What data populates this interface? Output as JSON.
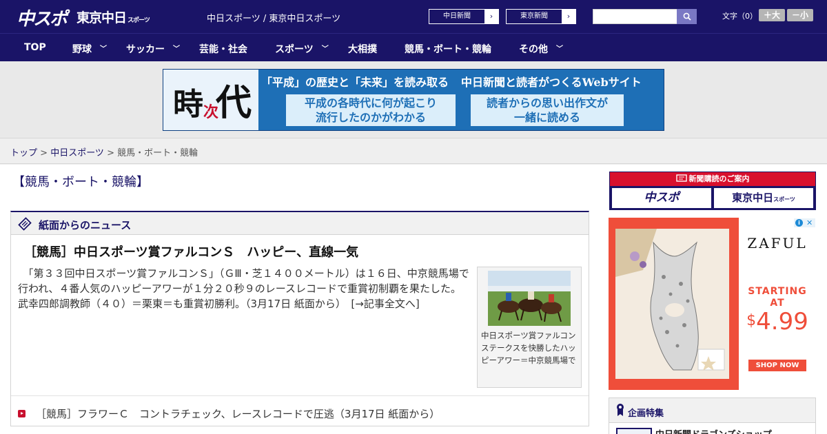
{
  "header": {
    "logo_chuspo": "中スポ",
    "logo_tokyo": "東京中日",
    "logo_tokyo_sub": "スポーツ",
    "site_names": "中日スポーツ / 東京中日スポーツ",
    "ext_links": [
      {
        "label": "中日新聞",
        "arrow": "›"
      },
      {
        "label": "東京新聞",
        "arrow": "›"
      }
    ],
    "search_placeholder": "",
    "font_size_label": "文字（0）",
    "font_plus": "＋大",
    "font_minus": "－小"
  },
  "nav": {
    "items": [
      {
        "label": "TOP",
        "chev": ""
      },
      {
        "label": "野球",
        "chev": "﹀"
      },
      {
        "label": "サッカー",
        "chev": "﹀"
      },
      {
        "label": "芸能・社会",
        "chev": ""
      },
      {
        "label": "スポーツ",
        "chev": "﹀"
      },
      {
        "label": "大相撲",
        "chev": ""
      },
      {
        "label": "競馬・ボート・競輪",
        "chev": ""
      },
      {
        "label": "その他",
        "chev": "﹀"
      }
    ]
  },
  "banner": {
    "kanji": [
      "時",
      "次",
      "代"
    ],
    "headline_left": "「平成」の歴史と「未来」を読み取る",
    "headline_right": "中日新聞と読者がつくるWebサイト",
    "box1": [
      "平成の各時代に何が起こり",
      "流行したのかがわかる"
    ],
    "box2": [
      "読者からの思い出作文が",
      "一緒に読める"
    ]
  },
  "breadcrumb": {
    "top": "トップ",
    "sep": " > ",
    "chunichi": "中日スポーツ",
    "current": "競馬・ボート・競輪"
  },
  "page_title": "【競馬・ボート・競輪】",
  "news": {
    "header_label": "紙面からのニュース",
    "article_title": "［競馬］中日スポーツ賞ファルコンＳ　ハッピー、直線一気",
    "article_body": "　「第３３回中日スポーツ賞ファルコンＳ」（ＧⅢ・芝１４００メートル）は１６日、中京競馬場で行われ、４番人気のハッピーアワーが１分２０秒９のレースレコードで重賞初制覇を果たした。武幸四郎調教師（４０）＝栗東＝も重賞初勝利。（3月17日 紙面から）　[→記事全文へ]",
    "photo_caption": "中日スポーツ賞ファルコンステークスを快勝したハッピーアワー＝中京競馬場で",
    "link_text": "［競馬］フラワーＣ　コントラチェック、レースレコードで圧逃（3月17日 紙面から）"
  },
  "sidebar": {
    "subscription_head": "新聞購読のご案内",
    "sub_logo_chuspo": "中スポ",
    "sub_logo_tokyo": "東京中日",
    "sub_logo_tokyo_sub": "スポーツ",
    "ad_brand": "ZAFUL",
    "ad_starting": [
      "STARTING",
      "AT"
    ],
    "ad_dollar": "$",
    "ad_price": "4.99",
    "ad_shop": "SHOP NOW",
    "ad_choice_i": "i",
    "ad_choice_x": "✕",
    "feature_label": "企画特集",
    "feature_item": "中日新聞ドラゴンズショップ"
  },
  "colors": {
    "navy": "#1a1467",
    "red": "#d8102d",
    "ad_red": "#ef4e3a"
  }
}
